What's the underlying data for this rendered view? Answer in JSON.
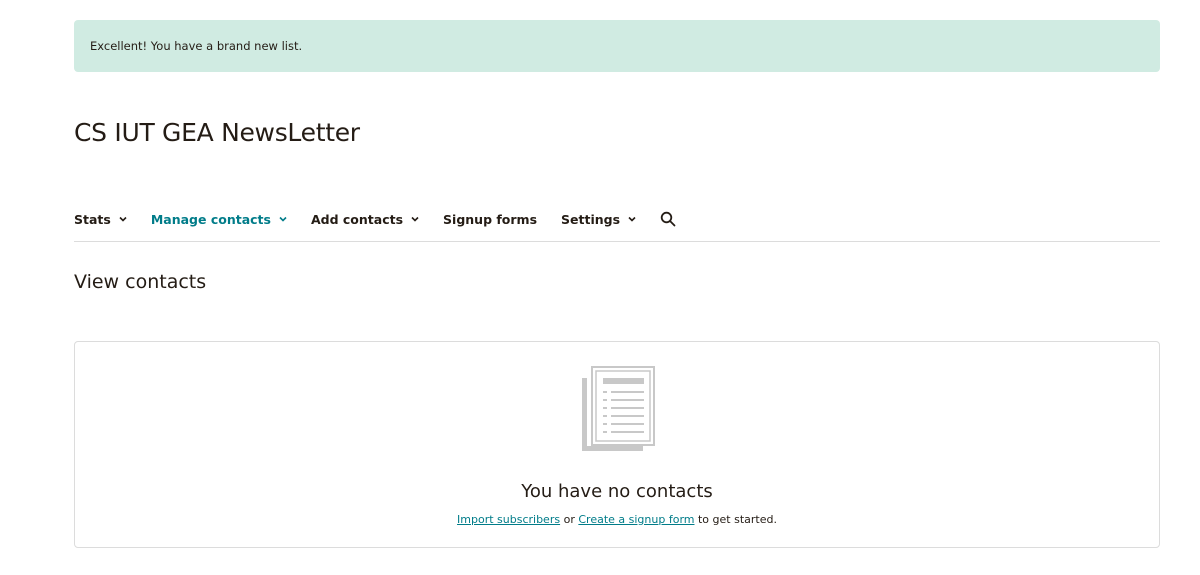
{
  "alert": {
    "message": "Excellent! You have a brand new list."
  },
  "list": {
    "title": "CS IUT GEA NewsLetter"
  },
  "nav": {
    "items": [
      {
        "label": "Stats",
        "has_dropdown": true,
        "active": false
      },
      {
        "label": "Manage contacts",
        "has_dropdown": true,
        "active": true
      },
      {
        "label": "Add contacts",
        "has_dropdown": true,
        "active": false
      },
      {
        "label": "Signup forms",
        "has_dropdown": false,
        "active": false
      },
      {
        "label": "Settings",
        "has_dropdown": true,
        "active": false
      }
    ],
    "search_icon": "search-icon"
  },
  "section": {
    "title": "View contacts"
  },
  "empty_state": {
    "icon": "document-list-icon",
    "title": "You have no contacts",
    "import_link": "Import subscribers",
    "or_text": "or",
    "signup_link": "Create a signup form",
    "suffix_text": "to get started."
  },
  "colors": {
    "accent": "#007c89",
    "alert_bg": "#d0ebe2",
    "text": "#241c15",
    "border": "#dcdcdc",
    "icon_gray": "#c8c8c8"
  }
}
